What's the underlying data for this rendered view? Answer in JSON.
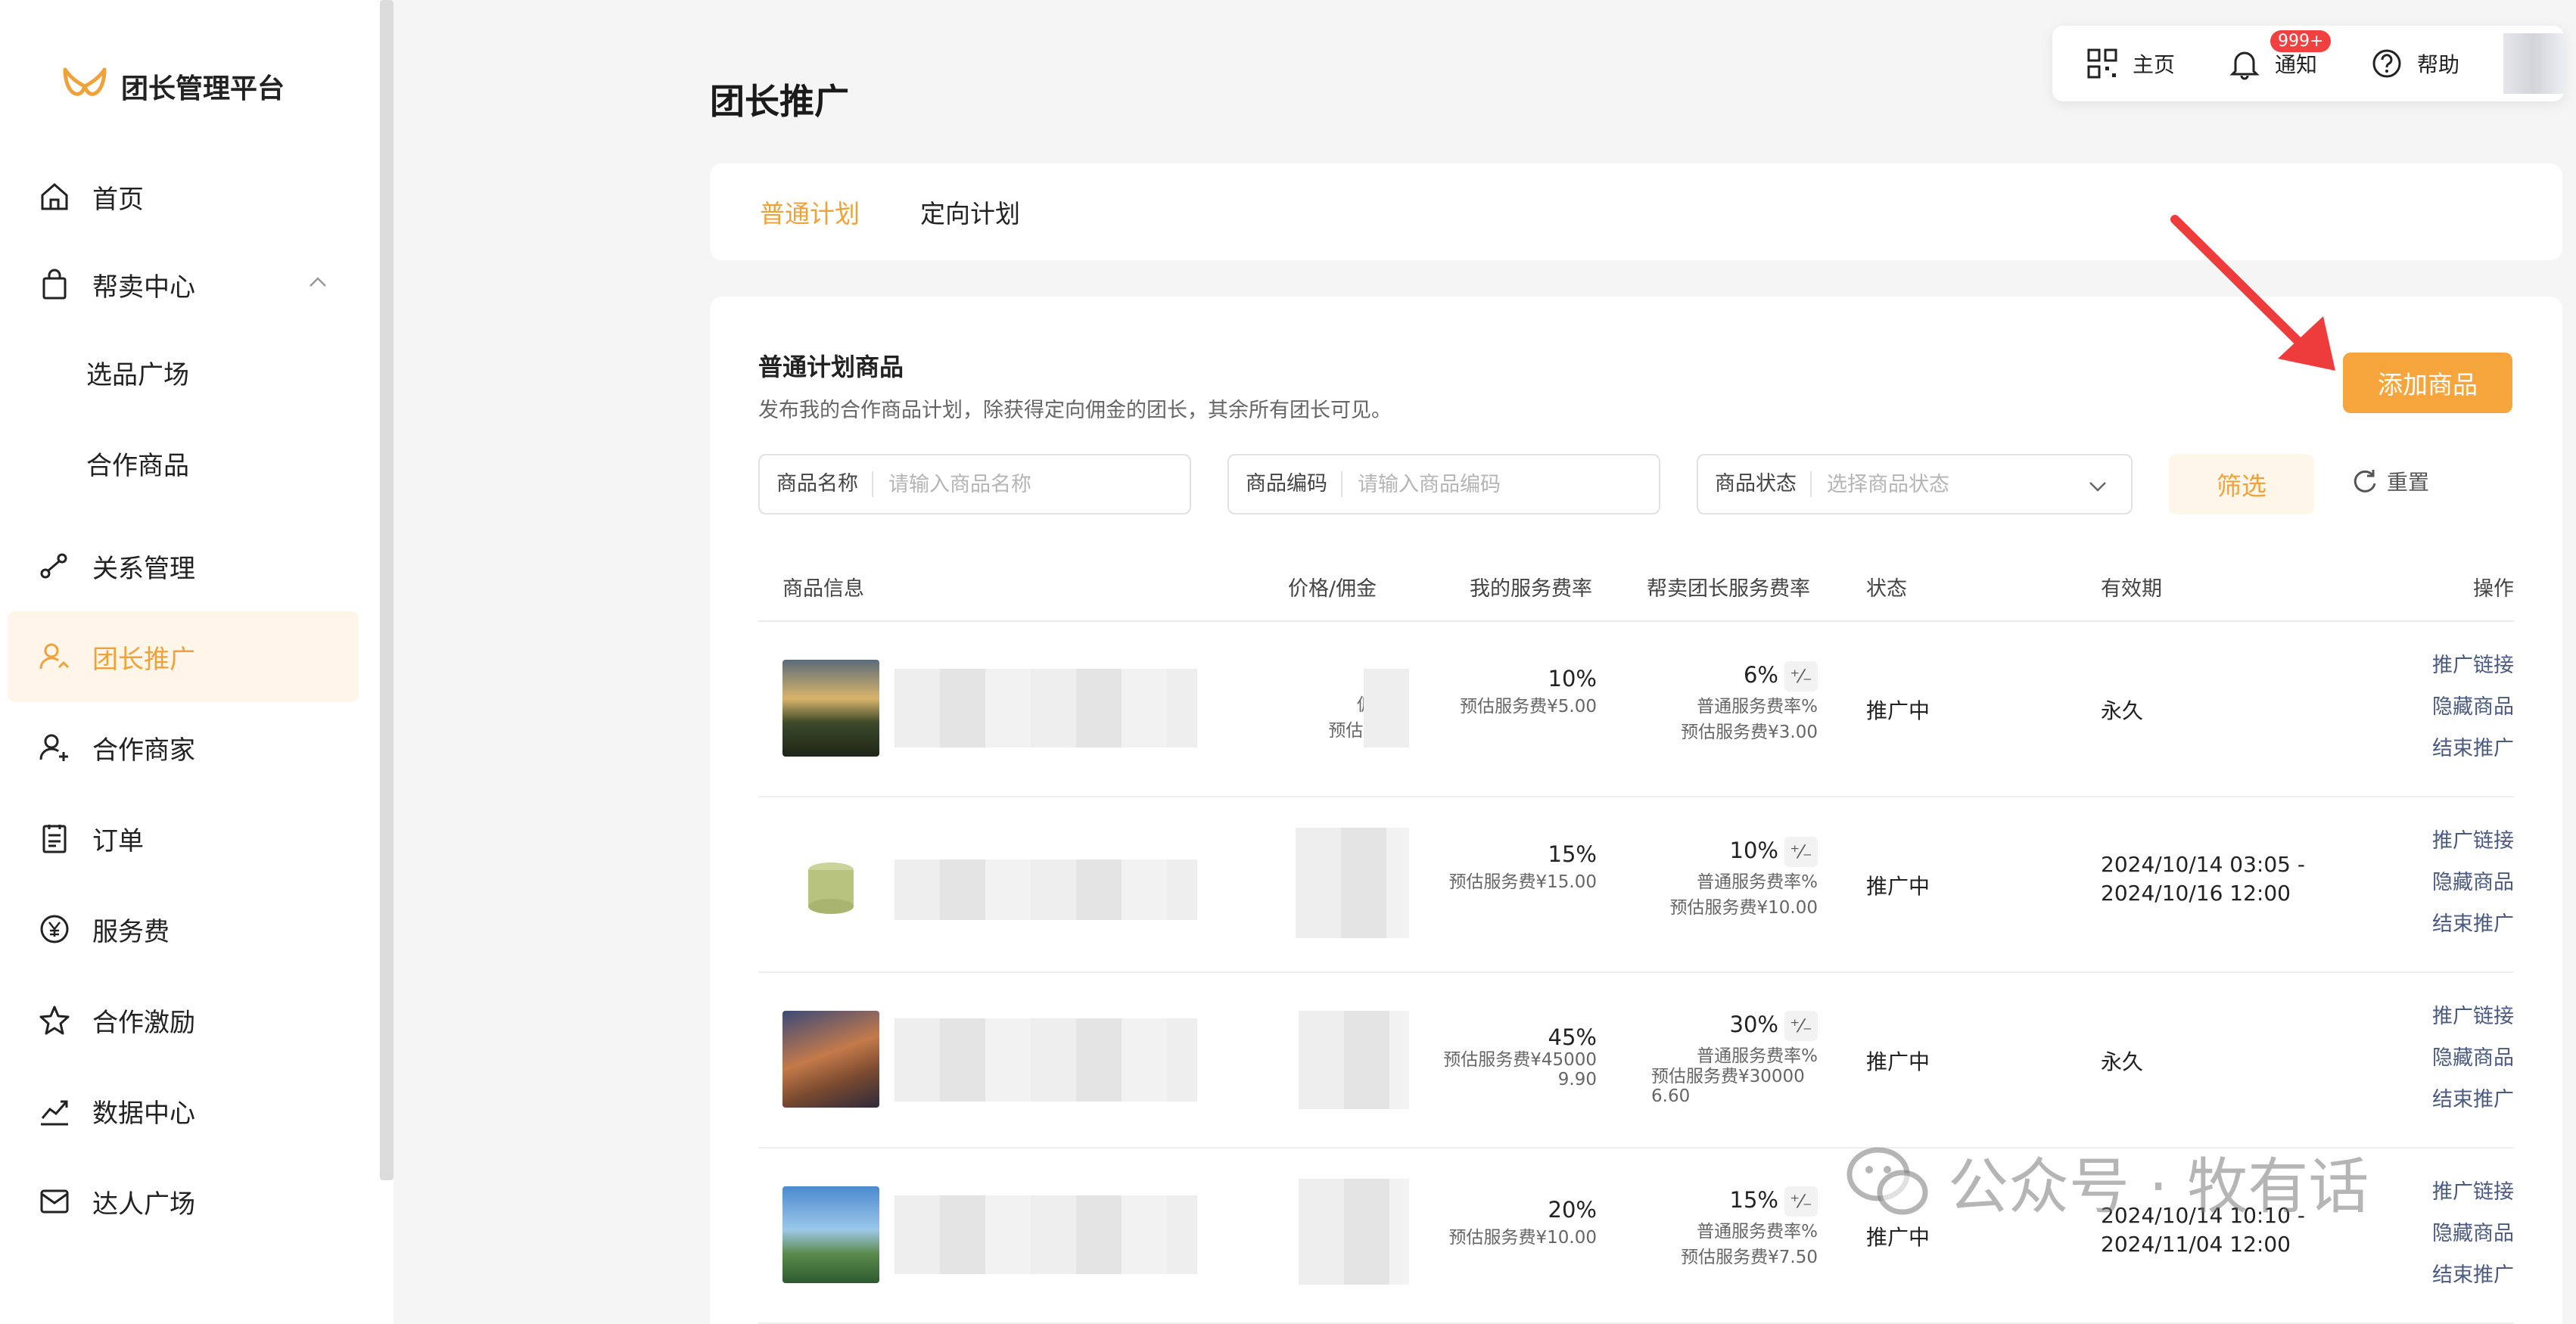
{
  "app": {
    "title": "团长管理平台"
  },
  "sidebar": {
    "items": [
      {
        "label": "首页",
        "icon": "home-icon"
      },
      {
        "label": "帮卖中心",
        "icon": "bag-icon"
      },
      {
        "label": "选品广场"
      },
      {
        "label": "合作商品"
      },
      {
        "label": "关系管理",
        "icon": "relation-icon"
      },
      {
        "label": "团长推广",
        "icon": "user-promote-icon",
        "active": true
      },
      {
        "label": "合作商家",
        "icon": "user-add-icon"
      },
      {
        "label": "订单",
        "icon": "clipboard-icon"
      },
      {
        "label": "服务费",
        "icon": "yen-icon"
      },
      {
        "label": "合作激励",
        "icon": "star-icon"
      },
      {
        "label": "数据中心",
        "icon": "chart-icon"
      },
      {
        "label": "达人广场",
        "icon": "mail-icon"
      }
    ]
  },
  "topbar": {
    "home_label": "主页",
    "notify_label": "通知",
    "notify_badge": "999+",
    "help_label": "帮助"
  },
  "page": {
    "title": "团长推广"
  },
  "tabs": [
    {
      "label": "普通计划",
      "active": true
    },
    {
      "label": "定向计划",
      "active": false
    }
  ],
  "section": {
    "title": "普通计划商品",
    "desc": "发布我的合作商品计划，除获得定向佣金的团长，其余所有团长可见。",
    "add_button": "添加商品"
  },
  "filters": {
    "name_label": "商品名称",
    "name_placeholder": "请输入商品名称",
    "code_label": "商品编码",
    "code_placeholder": "请输入商品编码",
    "status_label": "商品状态",
    "status_placeholder": "选择商品状态",
    "filter_button": "筛选",
    "reset_button": "重置"
  },
  "table": {
    "headers": [
      "商品信息",
      "价格/佣金",
      "我的服务费率",
      "帮卖团长服务费率",
      "状态",
      "有效期",
      "操作"
    ],
    "rows": [
      {
        "price": "¥",
        "commission_rate": "佣金率",
        "est_commission": "预估佣金¥",
        "my_rate": "10%",
        "my_fee": "预估服务费¥5.00",
        "helper_rate": "6%",
        "helper_rate_label": "普通服务费率%",
        "helper_fee": "预估服务费¥3.00",
        "status": "推广中",
        "validity": "永久",
        "ops": [
          "推广链接",
          "隐藏商品",
          "结束推广"
        ]
      },
      {
        "my_rate": "15%",
        "my_fee": "预估服务费¥15.00",
        "helper_rate": "10%",
        "helper_rate_label": "普通服务费率%",
        "helper_fee": "预估服务费¥10.00",
        "status": "推广中",
        "validity": "2024/10/14 03:05 - 2024/10/16 12:00",
        "ops": [
          "推广链接",
          "隐藏商品",
          "结束推广"
        ]
      },
      {
        "my_rate": "45%",
        "my_fee": "预估服务费¥45000 9.90",
        "helper_rate": "30%",
        "helper_rate_label": "普通服务费率%",
        "helper_fee": "预估服务费¥30000 6.60",
        "status": "推广中",
        "validity": "永久",
        "ops": [
          "推广链接",
          "隐藏商品",
          "结束推广"
        ]
      },
      {
        "my_rate": "20%",
        "my_fee": "预估服务费¥10.00",
        "helper_rate": "15%",
        "helper_rate_label": "普通服务费率%",
        "helper_fee": "预估服务费¥7.50",
        "status": "推广中",
        "validity": "2024/10/14 10:10 - 2024/11/04 12:00",
        "ops": [
          "推广链接",
          "隐藏商品",
          "结束推广"
        ]
      }
    ]
  },
  "watermark": {
    "text": "公众号 · 牧有话"
  },
  "colors": {
    "accent": "#f0a23a",
    "button": "#f5a53c",
    "link": "#4a5a80",
    "badge": "#f04040"
  }
}
